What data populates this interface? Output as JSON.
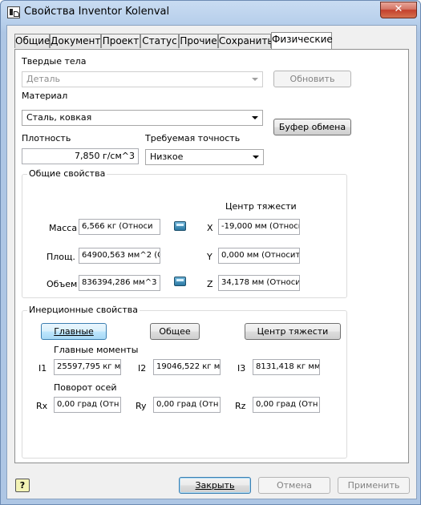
{
  "window": {
    "title": "Свойства Inventor Kolenval",
    "close_label": "✕"
  },
  "tabs": [
    {
      "label": "Общие"
    },
    {
      "label": "Документ"
    },
    {
      "label": "Проект"
    },
    {
      "label": "Статус"
    },
    {
      "label": "Прочие"
    },
    {
      "label": "Сохранить"
    },
    {
      "label": "Физические"
    }
  ],
  "physical": {
    "solids_label": "Твердые тела",
    "solids_value": "Деталь",
    "update_button": "Обновить",
    "material_label": "Материал",
    "material_value": "Сталь, ковкая",
    "clipboard_button": "Буфер обмена",
    "density_label": "Плотность",
    "density_value": "7,850 г/см^3",
    "accuracy_label": "Требуемая точность",
    "accuracy_value": "Низкое"
  },
  "general": {
    "title": "Общие свойства",
    "center_title": "Центр тяжести",
    "mass_label": "Масса",
    "mass_value": "6,566 кг (Относи",
    "area_label": "Площ.",
    "area_value": "64900,563 мм^2 (О",
    "volume_label": "Объем",
    "volume_value": "836394,286 мм^3 (",
    "x_label": "X",
    "x_value": "-19,000 мм (Относи",
    "y_label": "Y",
    "y_value": "0,000 мм (Относит",
    "z_label": "Z",
    "z_value": "34,178 мм (Относи"
  },
  "inertia": {
    "title": "Инерционные свойства",
    "btn_main": "Главные",
    "btn_global": "Общее",
    "btn_center": "Центр тяжести",
    "moments_title": "Главные моменты",
    "i1_label": "I1",
    "i1_value": "25597,795 кг м",
    "i2_label": "I2",
    "i2_value": "19046,522 кг м",
    "i3_label": "I3",
    "i3_value": "8131,418 кг мм",
    "rotation_title": "Поворот осей",
    "rx_label": "Rx",
    "rx_value": "0,00 град (Отн",
    "ry_label": "Ry",
    "ry_value": "0,00 град (Отн",
    "rz_label": "Rz",
    "rz_value": "0,00 град (Отн"
  },
  "footer": {
    "help_label": "?",
    "close_button": "Закрыть",
    "cancel_button": "Отмена",
    "apply_button": "Применить"
  }
}
